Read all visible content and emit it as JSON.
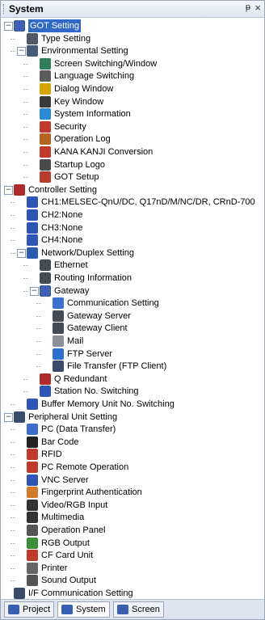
{
  "panel": {
    "title": "System",
    "pin_glyph": "ᵽ",
    "close_glyph": "×"
  },
  "tree": [
    {
      "label": "GOT Setting",
      "level": 0,
      "expander": "−",
      "icon": "got-setting-icon",
      "color": "#3b5fb0",
      "selected": true
    },
    {
      "label": "Type Setting",
      "level": 1,
      "icon": "type-setting-icon",
      "color": "#555b66"
    },
    {
      "label": "Environmental Setting",
      "level": 1,
      "expander": "−",
      "icon": "environment-icon",
      "color": "#4a5a7a"
    },
    {
      "label": "Screen Switching/Window",
      "level": 2,
      "icon": "screen-switch-icon",
      "color": "#2e7d5b"
    },
    {
      "label": "Language Switching",
      "level": 2,
      "icon": "language-icon",
      "color": "#5c5c5c"
    },
    {
      "label": "Dialog Window",
      "level": 2,
      "icon": "dialog-window-icon",
      "color": "#d9a400"
    },
    {
      "label": "Key Window",
      "level": 2,
      "icon": "key-window-icon",
      "color": "#3a3a3a"
    },
    {
      "label": "System Information",
      "level": 2,
      "icon": "system-info-icon",
      "color": "#2b8bd8"
    },
    {
      "label": "Security",
      "level": 2,
      "icon": "security-icon",
      "color": "#c0392b"
    },
    {
      "label": "Operation Log",
      "level": 2,
      "icon": "operation-log-icon",
      "color": "#b5651d"
    },
    {
      "label": "KANA KANJI Conversion",
      "level": 2,
      "icon": "kana-kanji-icon",
      "color": "#c0392b"
    },
    {
      "label": "Startup Logo",
      "level": 2,
      "icon": "startup-logo-icon",
      "color": "#4a4a4a"
    },
    {
      "label": "GOT Setup",
      "level": 2,
      "icon": "got-setup-icon",
      "color": "#b83a2a"
    },
    {
      "label": "Controller Setting",
      "level": 0,
      "expander": "−",
      "icon": "controller-icon",
      "color": "#b02a2a"
    },
    {
      "label": "CH1:MELSEC-QnU/DC, Q17nD/M/NC/DR, CRnD-700",
      "level": 1,
      "icon": "ch1-icon",
      "color": "#2e56b8"
    },
    {
      "label": "CH2:None",
      "level": 1,
      "icon": "ch2-icon",
      "color": "#2e56b8"
    },
    {
      "label": "CH3:None",
      "level": 1,
      "icon": "ch3-icon",
      "color": "#2e56b8"
    },
    {
      "label": "CH4:None",
      "level": 1,
      "icon": "ch4-icon",
      "color": "#2e56b8"
    },
    {
      "label": "Network/Duplex Setting",
      "level": 1,
      "expander": "−",
      "icon": "network-icon",
      "color": "#2a5db0"
    },
    {
      "label": "Ethernet",
      "level": 2,
      "icon": "ethernet-icon",
      "color": "#444b55"
    },
    {
      "label": "Routing Information",
      "level": 2,
      "icon": "routing-icon",
      "color": "#444b55"
    },
    {
      "label": "Gateway",
      "level": 2,
      "expander": "−",
      "icon": "gateway-icon",
      "color": "#3b5fb0"
    },
    {
      "label": "Communication Setting",
      "level": 3,
      "icon": "communication-setting-icon",
      "color": "#3a6fd0"
    },
    {
      "label": "Gateway Server",
      "level": 3,
      "icon": "gateway-server-icon",
      "color": "#444b55"
    },
    {
      "label": "Gateway Client",
      "level": 3,
      "icon": "gateway-client-icon",
      "color": "#444b55"
    },
    {
      "label": "Mail",
      "level": 3,
      "icon": "mail-icon",
      "color": "#8a8f99"
    },
    {
      "label": "FTP Server",
      "level": 3,
      "icon": "ftp-server-icon",
      "color": "#2a6fd0"
    },
    {
      "label": "File Transfer (FTP Client)",
      "level": 3,
      "icon": "file-transfer-icon",
      "color": "#3a4a6a"
    },
    {
      "label": "Q Redundant",
      "level": 2,
      "icon": "q-redundant-icon",
      "color": "#b02a2a"
    },
    {
      "label": "Station No. Switching",
      "level": 2,
      "icon": "station-switch-icon",
      "color": "#2e56b8"
    },
    {
      "label": "Buffer Memory Unit No. Switching",
      "level": 1,
      "icon": "buffer-memory-icon",
      "color": "#2e56b8"
    },
    {
      "label": "Peripheral Unit Setting",
      "level": 0,
      "expander": "−",
      "icon": "peripheral-icon",
      "color": "#3a4a6a"
    },
    {
      "label": "PC (Data Transfer)",
      "level": 1,
      "icon": "pc-transfer-icon",
      "color": "#3a6fd0"
    },
    {
      "label": "Bar Code",
      "level": 1,
      "icon": "barcode-icon",
      "color": "#222222"
    },
    {
      "label": "RFID",
      "level": 1,
      "icon": "rfid-icon",
      "color": "#c0392b"
    },
    {
      "label": "PC Remote Operation",
      "level": 1,
      "icon": "pc-remote-icon",
      "color": "#c0392b"
    },
    {
      "label": "VNC Server",
      "level": 1,
      "icon": "vnc-server-icon",
      "color": "#2e56b8"
    },
    {
      "label": "Fingerprint Authentication",
      "level": 1,
      "icon": "fingerprint-icon",
      "color": "#d07a2a"
    },
    {
      "label": "Video/RGB Input",
      "level": 1,
      "icon": "video-rgb-icon",
      "color": "#333333"
    },
    {
      "label": "Multimedia",
      "level": 1,
      "icon": "multimedia-icon",
      "color": "#333333"
    },
    {
      "label": "Operation Panel",
      "level": 1,
      "icon": "operation-panel-icon",
      "color": "#555555"
    },
    {
      "label": "RGB Output",
      "level": 1,
      "icon": "rgb-output-icon",
      "color": "#3a8f3a"
    },
    {
      "label": "CF Card Unit",
      "level": 1,
      "icon": "cf-card-icon",
      "color": "#c0392b"
    },
    {
      "label": "Printer",
      "level": 1,
      "icon": "printer-icon",
      "color": "#666666"
    },
    {
      "label": "Sound Output",
      "level": 1,
      "icon": "sound-output-icon",
      "color": "#555555"
    },
    {
      "label": "I/F Communication Setting",
      "level": 0,
      "icon": "if-communication-icon",
      "color": "#3a4a6a"
    }
  ],
  "tabs": [
    {
      "label": "Project",
      "icon": "project-tab-icon",
      "color": "#3b5fb0",
      "active": false
    },
    {
      "label": "System",
      "icon": "system-tab-icon",
      "color": "#3b5fb0",
      "active": true
    },
    {
      "label": "Screen",
      "icon": "screen-tab-icon",
      "color": "#3b5fb0",
      "active": false
    }
  ]
}
